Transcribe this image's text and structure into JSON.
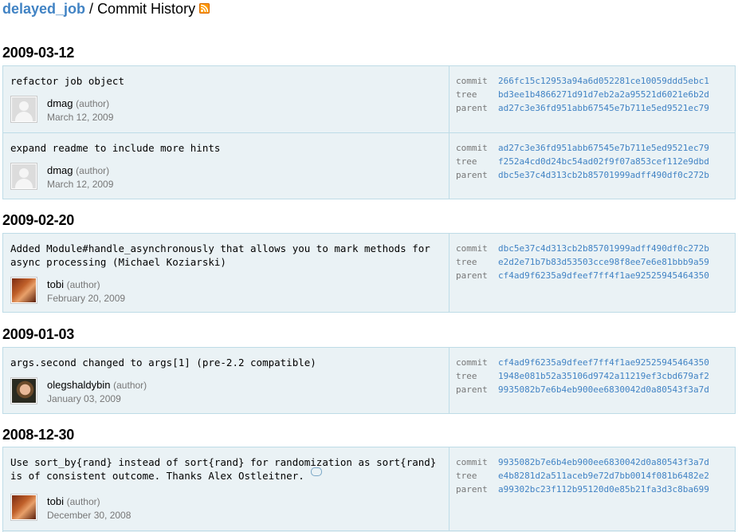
{
  "header": {
    "repo": "delayed_job",
    "separator": " / ",
    "title": "Commit History"
  },
  "days": [
    {
      "date": "2009-03-12",
      "commits": [
        {
          "message": "refactor job object",
          "author": "dmag",
          "role": "(author)",
          "date": "March 12, 2009",
          "avatar": "default",
          "commit": "266fc15c12953a94a6d052281ce10059ddd5ebc1",
          "tree": "bd3ee1b4866271d91d7eb2a2a95521d6021e6b2d",
          "parent": "ad27c3e36fd951abb67545e7b711e5ed9521ec79"
        },
        {
          "message": "expand readme to include more hints",
          "author": "dmag",
          "role": "(author)",
          "date": "March 12, 2009",
          "avatar": "default",
          "commit": "ad27c3e36fd951abb67545e7b711e5ed9521ec79",
          "tree": "f252a4cd0d24bc54ad02f9f07a853cef112e9dbd",
          "parent": "dbc5e37c4d313cb2b85701999adff490df0c272b"
        }
      ]
    },
    {
      "date": "2009-02-20",
      "commits": [
        {
          "message": "Added Module#handle_asynchronously that allows you to mark methods for async processing (Michael Koziarski)",
          "author": "tobi",
          "role": "(author)",
          "date": "February 20, 2009",
          "avatar": "tobi",
          "commit": "dbc5e37c4d313cb2b85701999adff490df0c272b",
          "tree": "e2d2e71b7b83d53503cce98f8ee7e6e81bbb9a59",
          "parent": "cf4ad9f6235a9dfeef7ff4f1ae92525945464350"
        }
      ]
    },
    {
      "date": "2009-01-03",
      "commits": [
        {
          "message": "args.second changed to args[1] (pre-2.2 compatible)",
          "author": "olegshaldybin",
          "role": "(author)",
          "date": "January 03, 2009",
          "avatar": "oleg",
          "commit": "cf4ad9f6235a9dfeef7ff4f1ae92525945464350",
          "tree": "1948e081b52a35106d9742a11219ef3cbd679af2",
          "parent": "9935082b7e6b4eb900ee6830042d0a80543f3a7d"
        }
      ]
    },
    {
      "date": "2008-12-30",
      "commits": [
        {
          "message": "Use sort_by{rand} instead of sort{rand} for randomization as sort{rand} is of consistent outcome. Thanks Alex Ostleitner.",
          "author": "tobi",
          "role": "(author)",
          "date": "December 30, 2008",
          "avatar": "tobi",
          "commit": "9935082b7e6b4eb900ee6830042d0a80543f3a7d",
          "tree": "e4b8281d2a511aceb9e72d7bb0014f081b6482e2",
          "parent": "a99302bc23f112b95120d0e85b21fa3d3c8ba699"
        }
      ]
    }
  ],
  "labels": {
    "commit": "commit",
    "tree": "tree",
    "parent": "parent"
  },
  "colors": {
    "link": "#4183c4",
    "box_bg": "#eaf2f5",
    "box_border": "#bedce7",
    "muted": "#777777"
  },
  "icons": {
    "feed": "rss-icon",
    "comment": "comment-bubble-icon"
  }
}
